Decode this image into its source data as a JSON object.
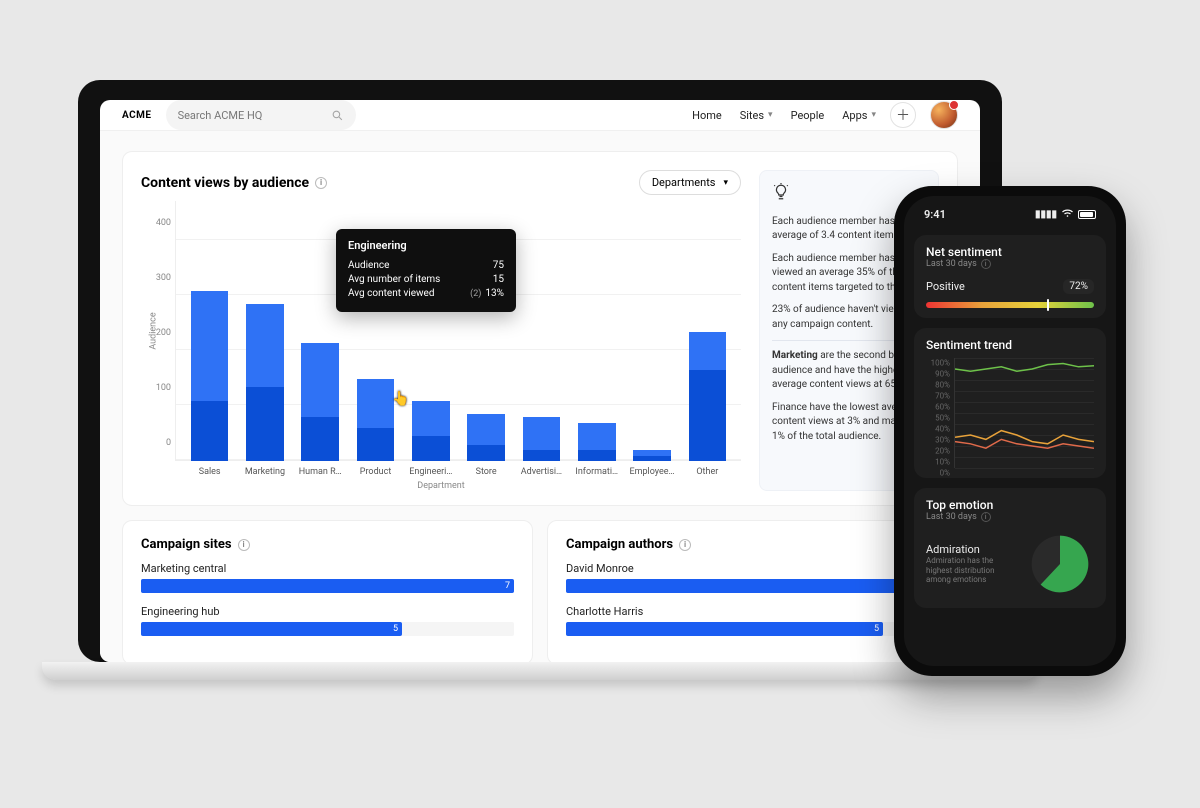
{
  "topbar": {
    "brand": "ACME",
    "search_placeholder": "Search ACME HQ",
    "nav": {
      "home": "Home",
      "sites": "Sites",
      "people": "People",
      "apps": "Apps"
    }
  },
  "chart_data": {
    "type": "bar",
    "title": "Content views by audience",
    "xlabel": "Department",
    "ylabel": "Audience",
    "ylim": [
      0,
      400
    ],
    "yticks": [
      0,
      100,
      200,
      300,
      400
    ],
    "categories": [
      "Sales",
      "Marketing",
      "Human R…",
      "Product",
      "Engineeri…",
      "Store",
      "Advertisi…",
      "Informati…",
      "Employee…",
      "Other"
    ],
    "series": [
      {
        "name": "segA",
        "color": "#0b4fd6",
        "values": [
          110,
          135,
          80,
          60,
          45,
          30,
          20,
          20,
          10,
          165
        ]
      },
      {
        "name": "segB",
        "color": "#2f72f5",
        "values": [
          200,
          150,
          135,
          90,
          65,
          55,
          60,
          50,
          10,
          70
        ]
      }
    ],
    "filter_label": "Departments",
    "tooltip": {
      "category": "Engineering",
      "rows": [
        {
          "label": "Audience",
          "value": "75"
        },
        {
          "label": "Avg number of items",
          "value": "15"
        },
        {
          "label": "Avg content viewed",
          "sub": "(2)",
          "value": "13%"
        }
      ],
      "hover_index": 4
    }
  },
  "insights": {
    "p1": "Each audience member has an average of 3.4 content items.",
    "p2": "Each audience member has viewed an average 35% of the content items targeted to them.",
    "p3": "23% of audience haven't viewed any campaign content.",
    "p4a": "Marketing",
    "p4b": " are the second biggest audience and have the highest average content views at 65%.",
    "p5": "Finance have the lowest average content views at 3% and make up 1% of the total audience."
  },
  "campaign_sites": {
    "title": "Campaign sites",
    "rows": [
      {
        "label": "Marketing central",
        "pct": 100,
        "value": "7"
      },
      {
        "label": "Engineering hub",
        "pct": 70,
        "value": "5"
      }
    ]
  },
  "campaign_authors": {
    "title": "Campaign authors",
    "rows": [
      {
        "label": "David Monroe",
        "pct": 100,
        "value": ""
      },
      {
        "label": "Charlotte Harris",
        "pct": 85,
        "value": "5"
      }
    ]
  },
  "phone": {
    "time": "9:41",
    "net_sentiment": {
      "title": "Net sentiment",
      "sub": "Last 30 days",
      "label": "Positive",
      "pct": "72%",
      "marker": 72
    },
    "sentiment_trend": {
      "title": "Sentiment trend",
      "yticks": [
        "100%",
        "90%",
        "80%",
        "70%",
        "60%",
        "50%",
        "40%",
        "30%",
        "20%",
        "10%",
        "0%"
      ],
      "series": [
        {
          "name": "positive",
          "color": "#6ec24a",
          "values": [
            90,
            88,
            90,
            92,
            88,
            90,
            94,
            95,
            92,
            93
          ]
        },
        {
          "name": "neutral",
          "color": "#e8a23a",
          "values": [
            28,
            30,
            26,
            34,
            30,
            24,
            22,
            30,
            26,
            24
          ]
        },
        {
          "name": "negative",
          "color": "#e06a4a",
          "values": [
            24,
            22,
            18,
            26,
            22,
            20,
            18,
            22,
            20,
            18
          ]
        }
      ]
    },
    "top_emotion": {
      "title": "Top emotion",
      "sub": "Last 30 days",
      "name": "Admiration",
      "desc": "Admiration has the highest distribution among emotions",
      "pie": {
        "pct": 62,
        "color": "#36a64f",
        "rest": "#2a2a2a"
      }
    }
  }
}
